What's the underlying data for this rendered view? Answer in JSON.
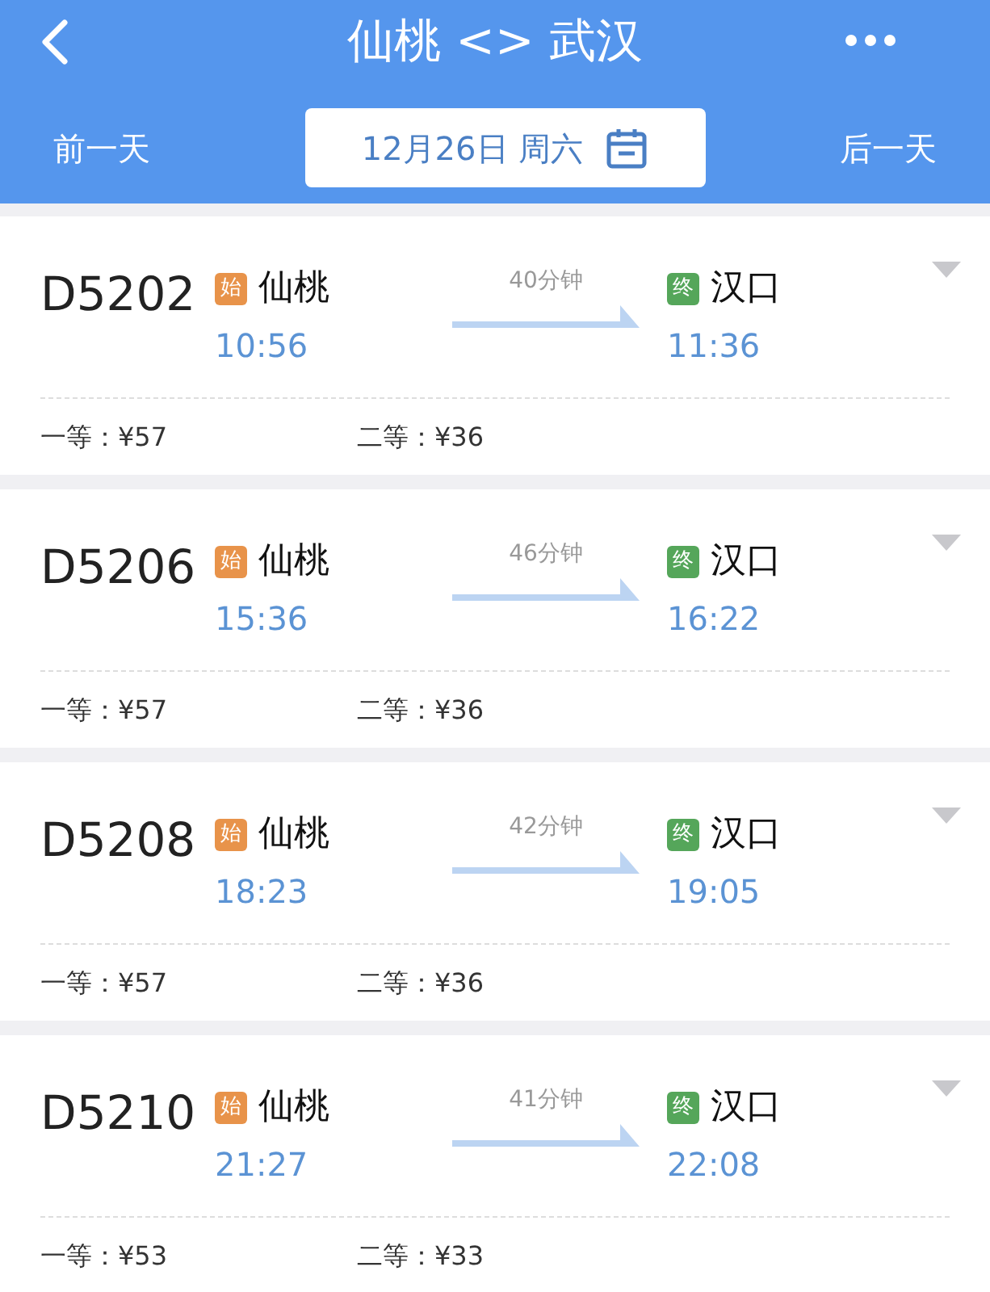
{
  "header": {
    "title": "仙桃 <> 武汉",
    "prev_day": "前一天",
    "date": "12月26日 周六",
    "next_day": "后一天"
  },
  "trains": [
    {
      "number": "D5202",
      "from_badge": "始",
      "from": "仙桃",
      "depart": "10:56",
      "duration": "40分钟",
      "to_badge": "终",
      "to": "汉口",
      "arrive": "11:36",
      "first_class": "一等：¥57",
      "second_class": "二等：¥36"
    },
    {
      "number": "D5206",
      "from_badge": "始",
      "from": "仙桃",
      "depart": "15:36",
      "duration": "46分钟",
      "to_badge": "终",
      "to": "汉口",
      "arrive": "16:22",
      "first_class": "一等：¥57",
      "second_class": "二等：¥36"
    },
    {
      "number": "D5208",
      "from_badge": "始",
      "from": "仙桃",
      "depart": "18:23",
      "duration": "42分钟",
      "to_badge": "终",
      "to": "汉口",
      "arrive": "19:05",
      "first_class": "一等：¥57",
      "second_class": "二等：¥36"
    },
    {
      "number": "D5210",
      "from_badge": "始",
      "from": "仙桃",
      "depart": "21:27",
      "duration": "41分钟",
      "to_badge": "终",
      "to": "汉口",
      "arrive": "22:08",
      "first_class": "一等：¥53",
      "second_class": "二等：¥33"
    }
  ]
}
